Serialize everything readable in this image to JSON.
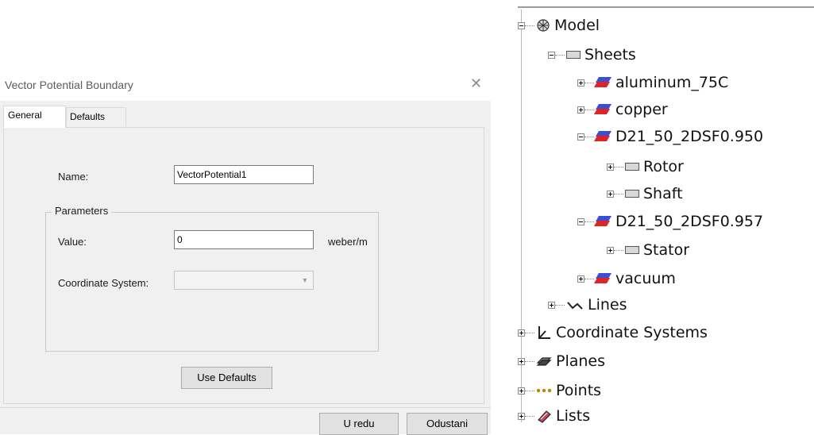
{
  "dialog": {
    "title": "Vector Potential Boundary",
    "close_glyph": "✕",
    "tabs": [
      {
        "label": "General",
        "selected": true
      },
      {
        "label": "Defaults",
        "selected": false
      }
    ],
    "name_label": "Name:",
    "name_value": "VectorPotential1",
    "parameters_group": "Parameters",
    "value_label": "Value:",
    "value_value": "0",
    "value_unit": "weber/m",
    "coord_label": "Coordinate System:",
    "coord_value": "",
    "use_defaults_button": "Use Defaults",
    "ok_button": "U redu",
    "cancel_button": "Odustani"
  },
  "tree": {
    "items": [
      {
        "label": "Model",
        "icon": "model-icon",
        "expanded": true
      },
      {
        "label": "Sheets",
        "icon": "sheet-icon",
        "expanded": true
      },
      {
        "label": "aluminum_75C",
        "icon": "material-sheet-icon",
        "expanded": false
      },
      {
        "label": "copper",
        "icon": "material-sheet-icon",
        "expanded": false
      },
      {
        "label": "D21_50_2DSF0.950",
        "icon": "material-sheet-icon",
        "expanded": true
      },
      {
        "label": "Rotor",
        "icon": "sheet-icon",
        "expanded": false
      },
      {
        "label": "Shaft",
        "icon": "sheet-icon",
        "expanded": false
      },
      {
        "label": "D21_50_2DSF0.957",
        "icon": "material-sheet-icon",
        "expanded": true
      },
      {
        "label": "Stator",
        "icon": "sheet-icon",
        "expanded": false
      },
      {
        "label": "vacuum",
        "icon": "material-sheet-icon",
        "expanded": false
      },
      {
        "label": "Lines",
        "icon": "line-icon",
        "expanded": false
      },
      {
        "label": "Coordinate Systems",
        "icon": "coordinate-system-icon",
        "expanded": false
      },
      {
        "label": "Planes",
        "icon": "plane-icon",
        "expanded": false
      },
      {
        "label": "Points",
        "icon": "points-icon",
        "expanded": false
      },
      {
        "label": "Lists",
        "icon": "list-icon",
        "expanded": false
      }
    ]
  },
  "colors": {
    "dialog_bg": "#f0f0f0",
    "material_top": "#3a4fd8",
    "material_bottom": "#e02323"
  }
}
